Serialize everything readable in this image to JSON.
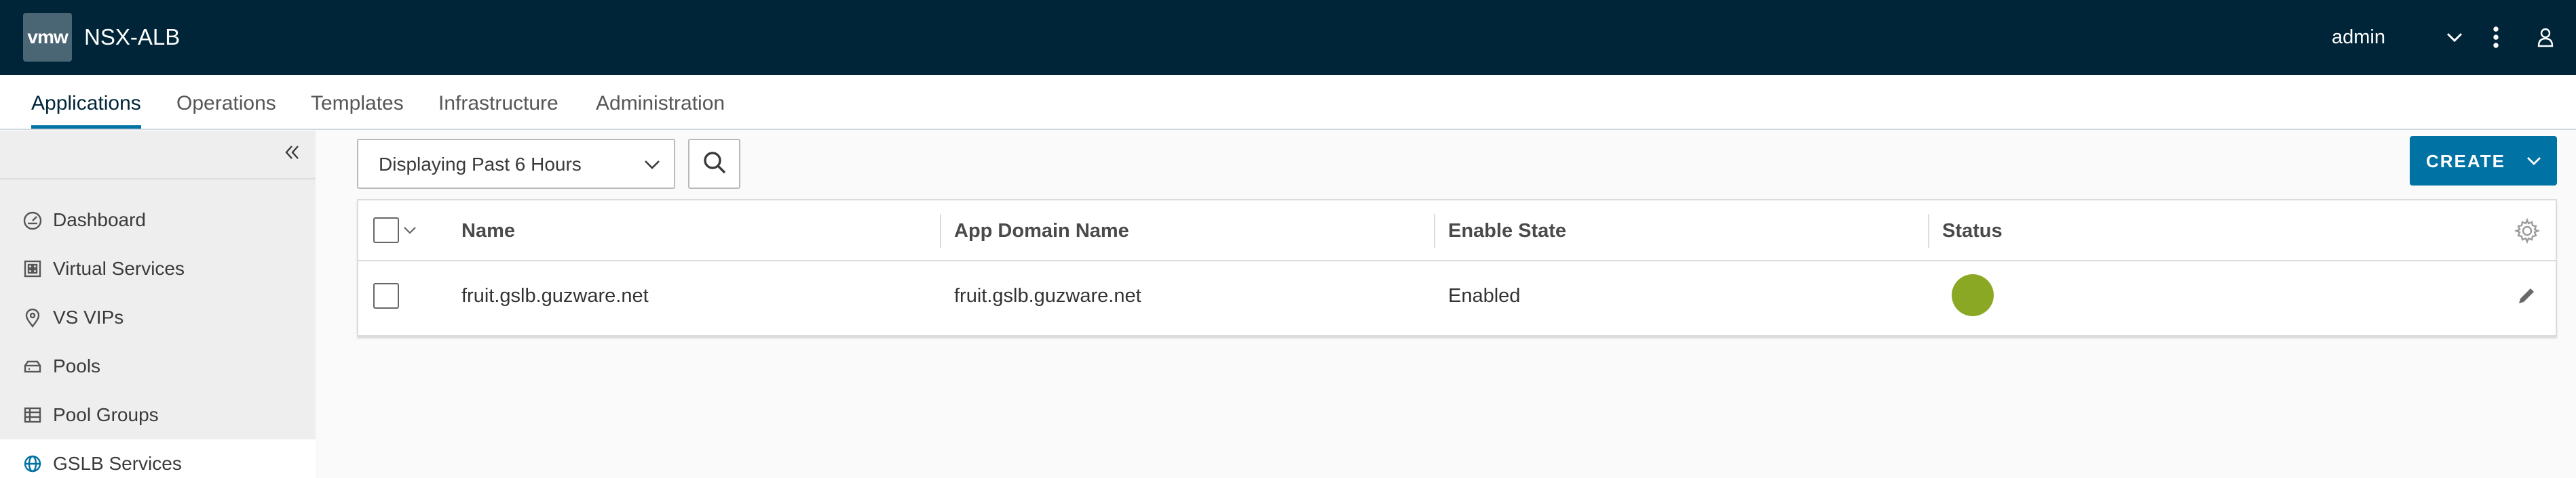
{
  "header": {
    "logo": "vmw",
    "title": "NSX-ALB",
    "user": "admin",
    "icons": [
      "chevron-down-icon",
      "more-vertical-icon",
      "user-icon"
    ]
  },
  "nav": {
    "tabs": [
      {
        "label": "Applications",
        "active": true
      },
      {
        "label": "Operations",
        "active": false
      },
      {
        "label": "Templates",
        "active": false
      },
      {
        "label": "Infrastructure",
        "active": false
      },
      {
        "label": "Administration",
        "active": false
      }
    ]
  },
  "sidebar": {
    "items": [
      {
        "label": "Dashboard",
        "icon": "dashboard-icon",
        "active": false
      },
      {
        "label": "Virtual Services",
        "icon": "virtual-services-icon",
        "active": false
      },
      {
        "label": "VS VIPs",
        "icon": "map-marker-icon",
        "active": false
      },
      {
        "label": "Pools",
        "icon": "pool-icon",
        "active": false
      },
      {
        "label": "Pool Groups",
        "icon": "pool-groups-icon",
        "active": false
      },
      {
        "label": "GSLB Services",
        "icon": "globe-icon",
        "active": true
      }
    ]
  },
  "toolbar": {
    "time_range": "Displaying Past 6 Hours",
    "create_label": "CREATE"
  },
  "grid": {
    "columns": [
      "Name",
      "App Domain Name",
      "Enable State",
      "Status"
    ],
    "rows": [
      {
        "name": "fruit.gslb.guzware.net",
        "app_domain_name": "fruit.gslb.guzware.net",
        "enable_state": "Enabled",
        "status_color": "#8aa824"
      }
    ]
  },
  "colors": {
    "header_bg": "#002538",
    "accent": "#0072a3",
    "status_up": "#8aa824"
  }
}
